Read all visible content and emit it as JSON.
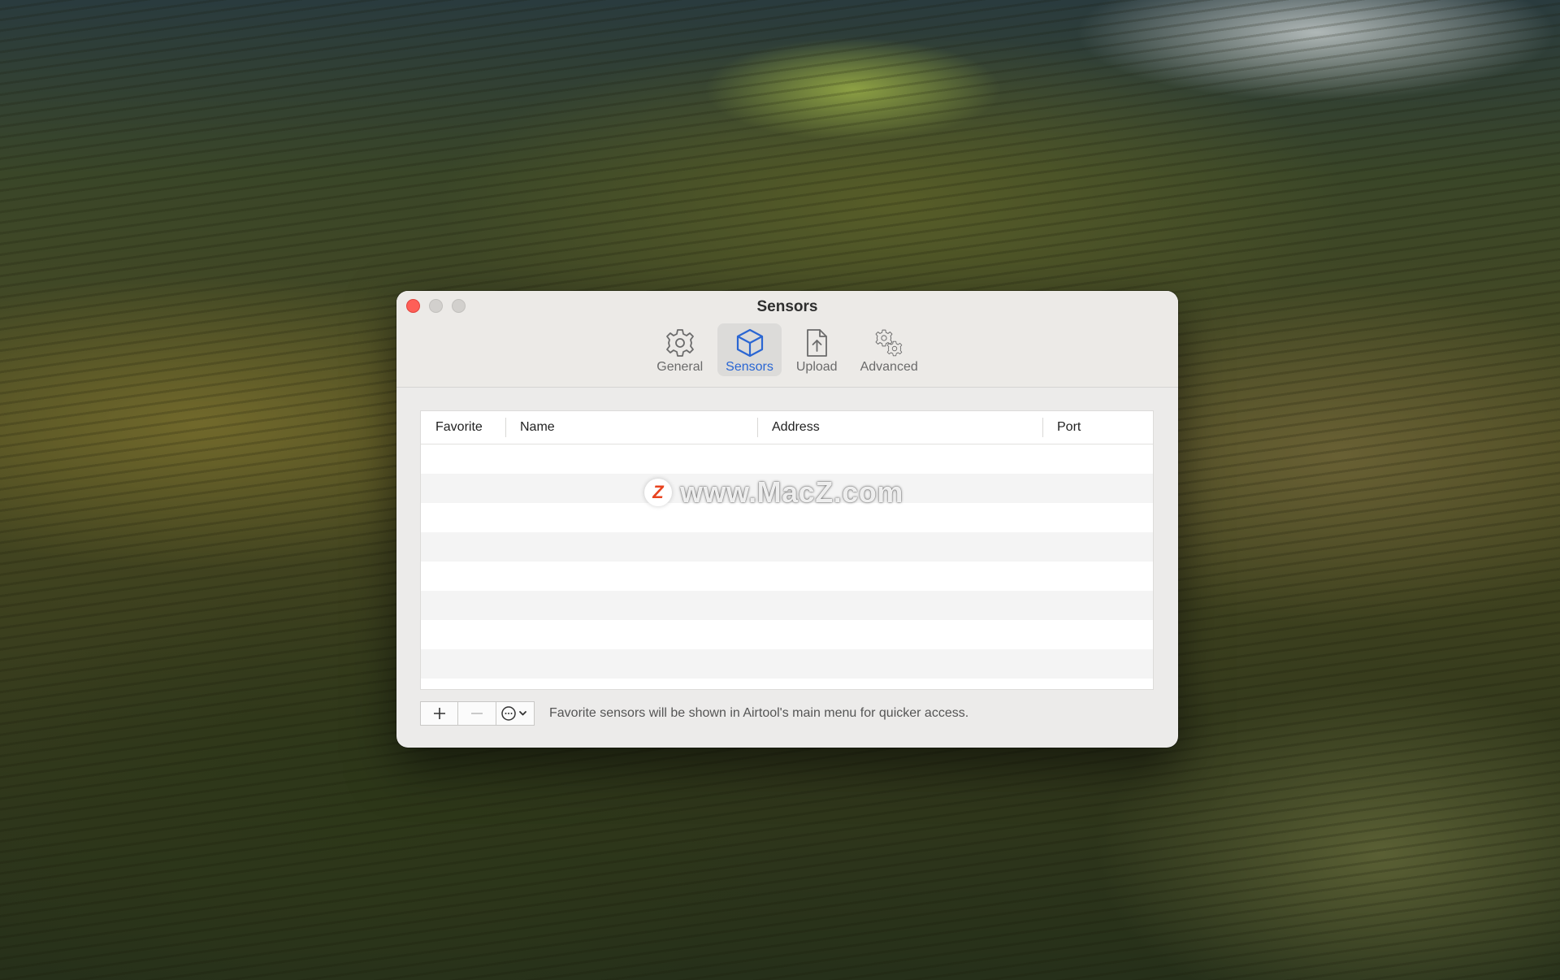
{
  "window": {
    "title": "Sensors",
    "toolbar": [
      {
        "id": "general",
        "label": "General",
        "icon": "gear-icon",
        "active": false
      },
      {
        "id": "sensors",
        "label": "Sensors",
        "icon": "cube-icon",
        "active": true
      },
      {
        "id": "upload",
        "label": "Upload",
        "icon": "upload-document-icon",
        "active": false
      },
      {
        "id": "advanced",
        "label": "Advanced",
        "icon": "gears-icon",
        "active": false
      }
    ],
    "accent_color": "#2a66d3"
  },
  "table": {
    "columns": [
      "Favorite",
      "Name",
      "Address",
      "Port"
    ],
    "rows": []
  },
  "footer": {
    "add_label": "+",
    "remove_label": "—",
    "actions_icon": "ellipsis-circle-icon",
    "hint": "Favorite sensors will be shown in Airtool's main menu for quicker access."
  },
  "watermark": {
    "badge": "Z",
    "text": "www.MacZ.com"
  }
}
